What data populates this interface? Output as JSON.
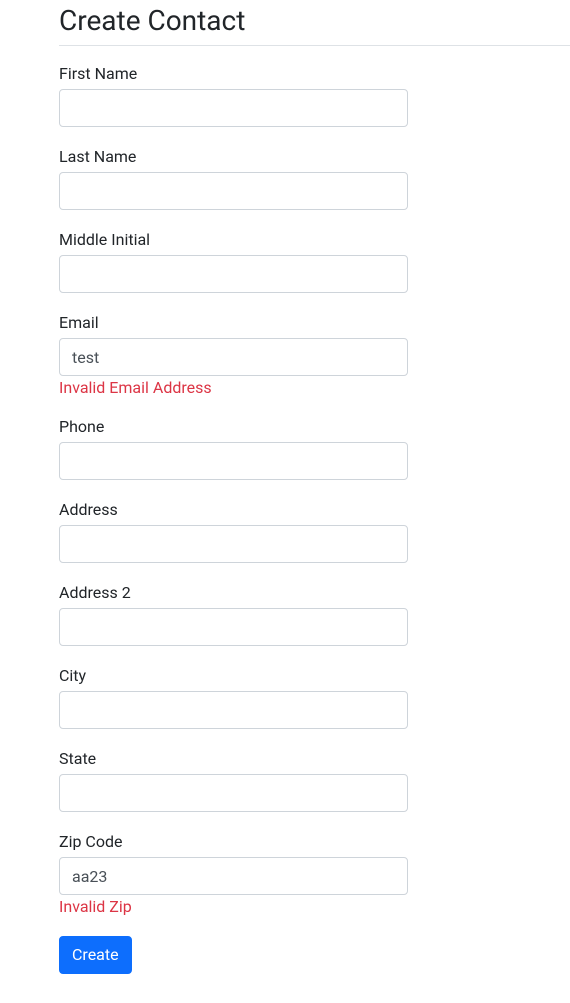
{
  "page": {
    "title": "Create Contact"
  },
  "form": {
    "fields": {
      "first_name": {
        "label": "First Name",
        "value": "",
        "error": ""
      },
      "last_name": {
        "label": "Last Name",
        "value": "",
        "error": ""
      },
      "middle_initial": {
        "label": "Middle Initial",
        "value": "",
        "error": ""
      },
      "email": {
        "label": "Email",
        "value": "test",
        "error": "Invalid Email Address"
      },
      "phone": {
        "label": "Phone",
        "value": "",
        "error": ""
      },
      "address": {
        "label": "Address",
        "value": "",
        "error": ""
      },
      "address2": {
        "label": "Address 2",
        "value": "",
        "error": ""
      },
      "city": {
        "label": "City",
        "value": "",
        "error": ""
      },
      "state": {
        "label": "State",
        "value": "",
        "error": ""
      },
      "zip": {
        "label": "Zip Code",
        "value": "aa23",
        "error": "Invalid Zip"
      }
    },
    "submit_label": "Create"
  }
}
